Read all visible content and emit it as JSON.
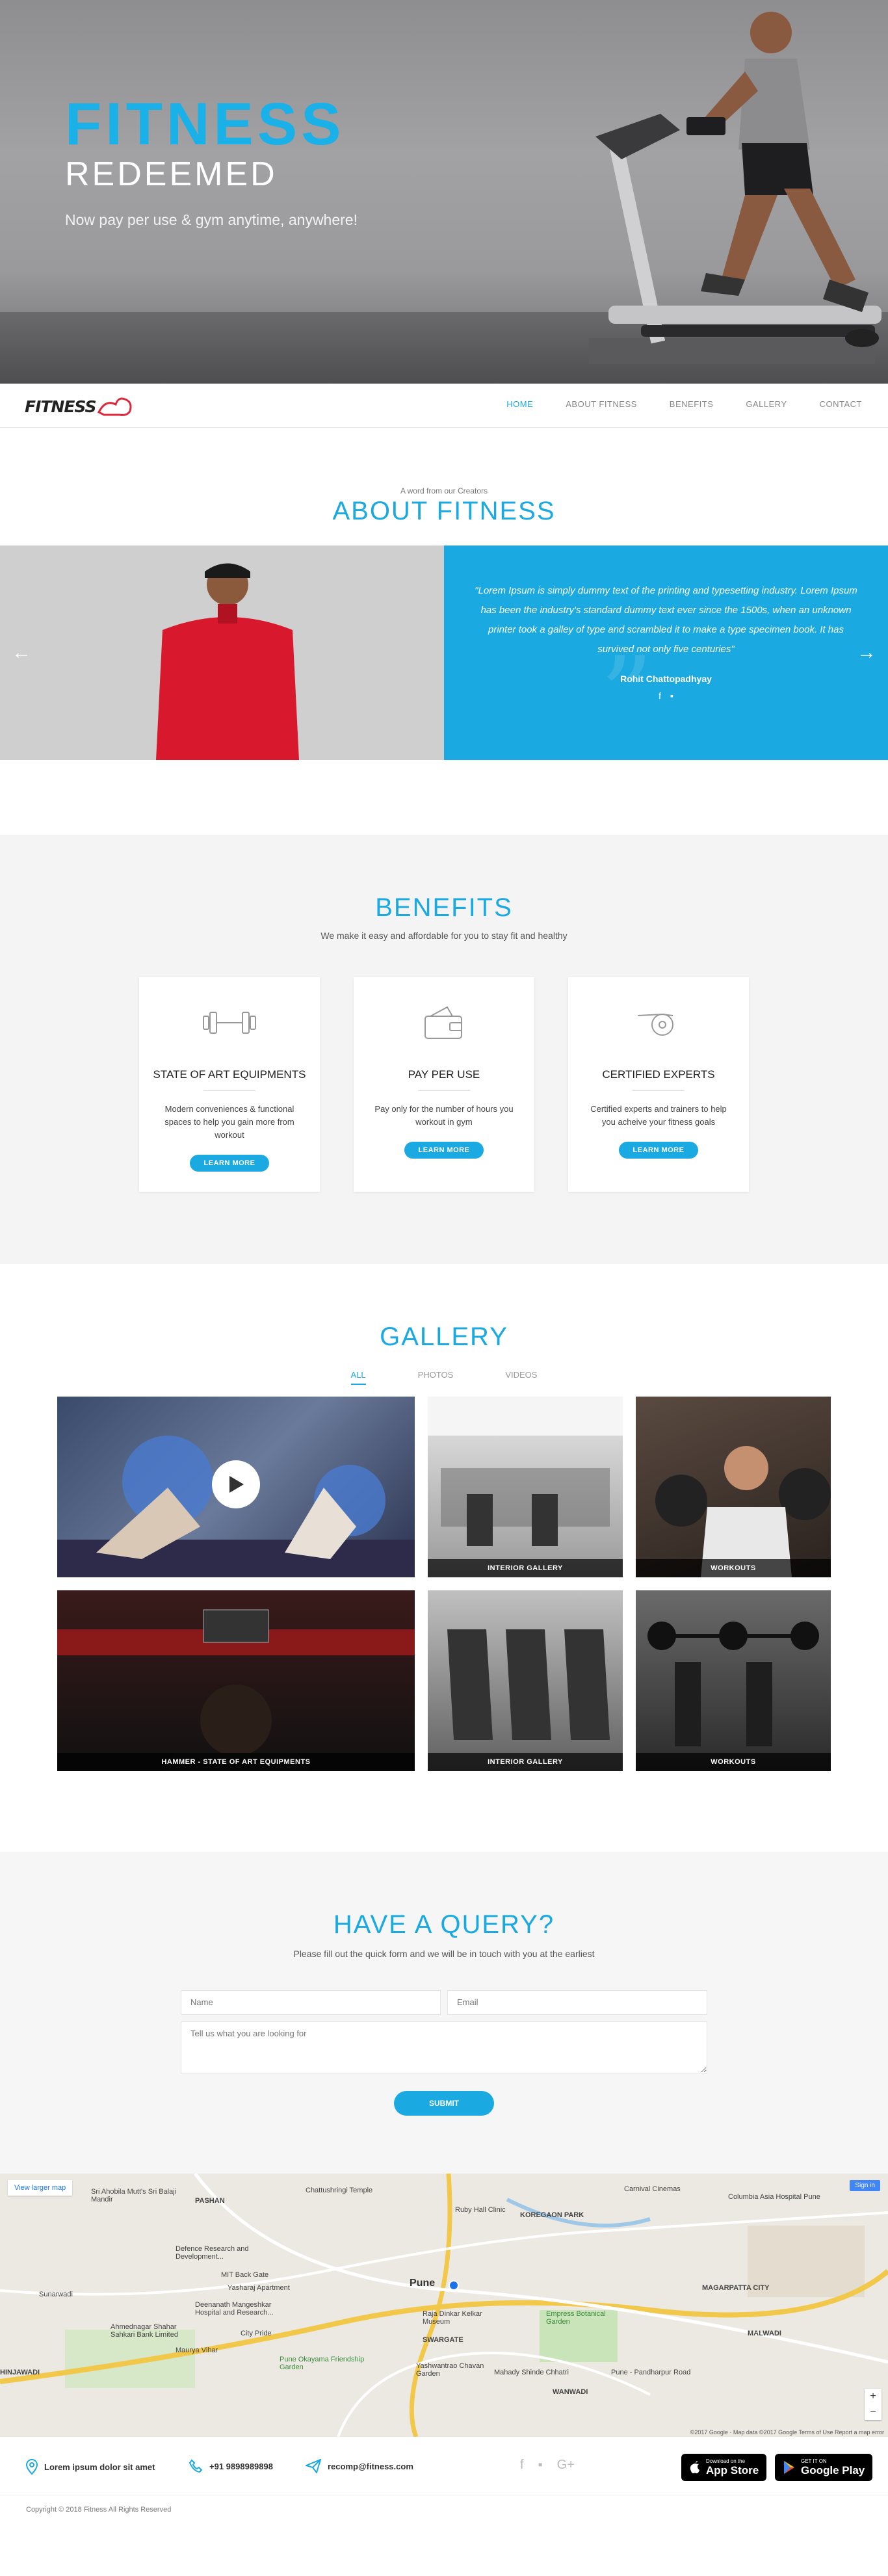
{
  "hero": {
    "title": "FITNESS",
    "subtitle": "REDEEMED",
    "tagline": "Now pay per use & gym anytime, anywhere!"
  },
  "nav": {
    "logo": "FITNESS",
    "items": [
      "HOME",
      "ABOUT FITNESS",
      "BENEFITS",
      "GALLERY",
      "CONTACT"
    ],
    "active": "HOME"
  },
  "about": {
    "kicker": "A word from our Creators",
    "title": "ABOUT FITNESS",
    "quote": "\"Lorem Ipsum is simply dummy text of the printing and typesetting industry. Lorem Ipsum has been the industry's standard dummy text ever since the 1500s, when an unknown printer took a galley of type and scrambled it to make a type specimen book. It has survived not only five centuries\"",
    "author": "Rohit Chattopadhyay",
    "prev_icon": "arrow-left-icon",
    "next_icon": "arrow-right-icon"
  },
  "benefits": {
    "title": "BENEFITS",
    "intro": "We make it easy and affordable for you to stay fit and healthy",
    "cards": [
      {
        "title": "STATE OF ART EQUIPMENTS",
        "text": "Modern conveniences & functional spaces to help you gain more from workout",
        "button": "LEARN MORE",
        "icon": "dumbbell-icon"
      },
      {
        "title": "PAY PER USE",
        "text": "Pay only for the number of hours you workout in gym",
        "button": "LEARN MORE",
        "icon": "wallet-icon"
      },
      {
        "title": "CERTIFIED EXPERTS",
        "text": "Certified experts and trainers to help you acheive your fitness goals",
        "button": "LEARN MORE",
        "icon": "whistle-icon"
      }
    ]
  },
  "gallery": {
    "title": "GALLERY",
    "tabs": [
      "ALL",
      "PHOTOS",
      "VIDEOS"
    ],
    "active_tab": "ALL",
    "captions": [
      "INTERIOR GALLERY",
      "WORKOUTS",
      "HAMMER - STATE OF ART EQUIPMENTS",
      "INTERIOR GALLERY",
      "WORKOUTS"
    ]
  },
  "query": {
    "title": "HAVE A QUERY?",
    "intro": "Please fill out the quick form and we will be in touch with you at the earliest",
    "name_ph": "Name",
    "email_ph": "Email",
    "message_ph": "Tell us what you are looking for",
    "submit": "SUBMIT"
  },
  "map": {
    "view_larger": "View larger map",
    "sign_in": "Sign in",
    "labels": [
      "Chattushringi Temple",
      "Ruby Hall Clinic",
      "KOREGAON PARK",
      "Carnival Cinemas",
      "Columbia Asia Hospital Pune",
      "PASHAN",
      "Sri Ahobila Mutt's Sri Balaji Mandir",
      "Defence Research and Development...",
      "MIT Back Gate",
      "Yasharaj Apartment",
      "Deenanath Mangeshkar Hospital and Research...",
      "Ahmednagar Shahar Sahkari Bank Limited",
      "City Pride",
      "Maurya Vihar",
      "Pune Okayama Friendship Garden",
      "Pune",
      "Raja Dinkar Kelkar Museum",
      "SWARGATE",
      "Empress Botanical Garden",
      "MAGARPATTA CITY",
      "MALWADI",
      "Yashwantrao Chavan Garden",
      "Mahady Shinde Chhatri",
      "WANWADI",
      "Sunarwadi",
      "HINJAWADI",
      "Pune - Pandharpur Road"
    ],
    "footer": "©2017 Google · Map data ©2017 Google   Terms of Use   Report a map error"
  },
  "footer": {
    "address": "Lorem ipsum dolor sit amet",
    "phone": "+91 9898989898",
    "email": "recomp@fitness.com",
    "appstore_top": "Download on the",
    "appstore": "App Store",
    "play_top": "GET IT ON",
    "play": "Google Play",
    "copyright": "Copyright © 2018 Fitness All Rights Reserved"
  },
  "colors": {
    "accent": "#1aa9e0",
    "hero_bg": "#9a9a9c",
    "footer_store": "#000000"
  }
}
